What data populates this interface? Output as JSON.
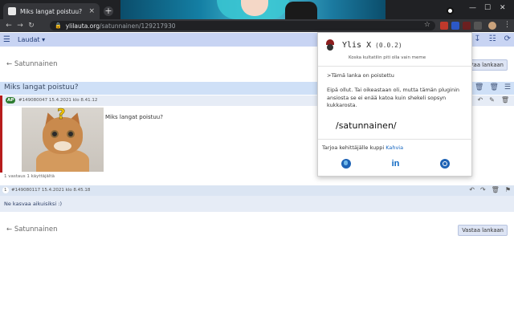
{
  "browser": {
    "tab_title": "Miks langat poistuu? | Ylilauta",
    "tab_close": "×",
    "new_tab": "+",
    "url_host": "ylilauta.org",
    "url_path": "/satunnainen/129217930",
    "nav_back": "←",
    "nav_forward": "→",
    "nav_reload": "↻",
    "lock_icon": "🔒",
    "star_icon": "☆",
    "win_min": "—",
    "win_max": "☐",
    "win_close": "✕",
    "kebab": "⋮"
  },
  "site": {
    "menu_icon": "☰",
    "boards_label": "Laudat ▾",
    "bar_icons": [
      "⚙",
      "↧",
      "☷",
      "⟳"
    ]
  },
  "thread": {
    "back_label": "← Satunnainen",
    "reply_label": "Vastaa lankaan",
    "title": "Miks langat poistuu?",
    "title_actions": [
      "☆",
      "🗑",
      "🗑",
      "☰"
    ],
    "op": {
      "badge": "AP",
      "meta": "#149080047  15.4.2021 klo 8.41.12",
      "text": "Miks langat poistuu?",
      "actions": [
        "↶",
        "✎",
        "🗑"
      ],
      "image_mark": "?",
      "footer": "1 vastaus 1 käyttäjältä"
    },
    "reply": {
      "num": "1",
      "meta": "#149080117  15.4.2021 klo 8.45.18",
      "text": "Ne kasvaa aikuisiksi :)",
      "actions": [
        "↶",
        "↷",
        "🗑",
        "⚑"
      ]
    }
  },
  "popup": {
    "title": "Ylis X",
    "version": "(0.0.2)",
    "tagline": "Koska kultatilin piti olla vain meme",
    "quote": ">Tämä lanka on poistettu",
    "body": "Eipä ollut. Tai oikeastaan oli, mutta tämän pluginin ansiosta se ei enää katoa kuin shekeli sopsyn kukkarosta.",
    "board": "/satunnainen/",
    "support_prefix": "Tarjoa kehittäjälle kuppi ",
    "support_link": "Kahvia",
    "linkedin_label": "in"
  },
  "colors": {
    "accent_red": "#b71c1c",
    "site_bar": "#c8d4f3",
    "link_blue": "#1565c0"
  }
}
